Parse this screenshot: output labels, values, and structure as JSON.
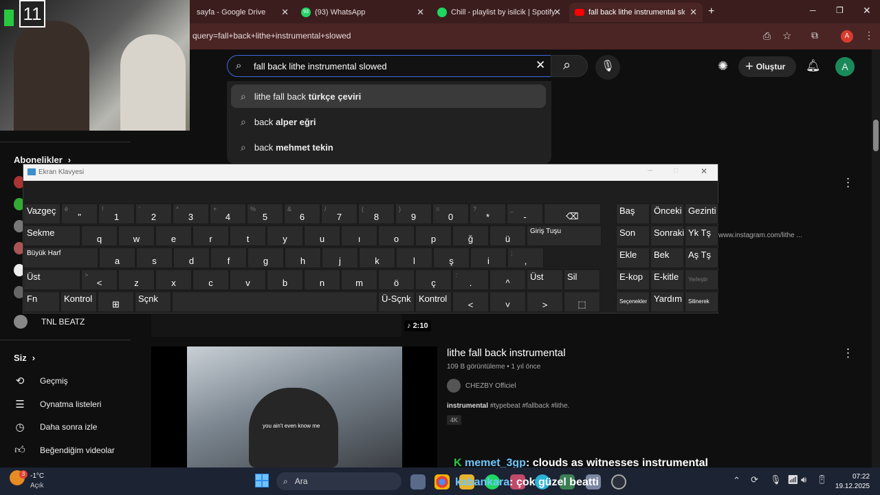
{
  "browser": {
    "tabs": [
      {
        "label": "sayfa - Google Drive"
      },
      {
        "label": "(93) WhatsApp",
        "badge": "93"
      },
      {
        "label": "Chill - playlist by isilcik | Spotify"
      },
      {
        "label": "fall back lithe instrumental slowed"
      }
    ],
    "url": "query=fall+back+lithe+instrumental+slowed",
    "profile_initial": "A"
  },
  "youtube": {
    "search": {
      "value": "fall back lithe instrumental slowed"
    },
    "suggestions": [
      {
        "prefix": "lithe fall back ",
        "bold": "türkçe çeviri"
      },
      {
        "prefix": "back ",
        "bold": "alper eğri"
      },
      {
        "prefix": "back ",
        "bold": "mehmet tekin"
      }
    ],
    "create_label": "Oluştur",
    "avatar_initial": "A",
    "sidebar": {
      "subs_header": "Abonelikler",
      "subs_last": "TNL BEATZ",
      "you_header": "Siz",
      "items": [
        "Geçmiş",
        "Oynatma listeleri",
        "Daha sonra izle",
        "Beğendiğim videolar"
      ]
    },
    "result1": {
      "snippet": "www.instagram.com/lithe ...",
      "duration": "2:10"
    },
    "result2": {
      "title": "lithe fall back instrumental",
      "meta": "109 B görüntüleme • 1 yıl önce",
      "channel": "CHEZBY Officiel",
      "desc_pre": "instrumental",
      "desc_rest": " #typebeat #fallback #lithe.",
      "badge": "4K",
      "thumb_caption": "you ain't even know me"
    }
  },
  "stream": {
    "webcam_counter": "11",
    "chat1": {
      "user": "memet_3gp",
      "msg": ": clouds as witnesses instrumental"
    },
    "chat2": {
      "user": "kabankara",
      "msg": ": çok güzel beatti"
    }
  },
  "osk": {
    "title": "Ekran Klavyesi",
    "rows": [
      [
        [
          "Vazgeç",
          ""
        ],
        [
          "\"",
          "é"
        ],
        [
          "1",
          "!"
        ],
        [
          "2",
          "'"
        ],
        [
          "3",
          "^"
        ],
        [
          "4",
          "+"
        ],
        [
          "5",
          "%"
        ],
        [
          "6",
          "&"
        ],
        [
          "7",
          "/"
        ],
        [
          "8",
          "("
        ],
        [
          "9",
          ")"
        ],
        [
          "0",
          "="
        ],
        [
          "*",
          "?"
        ],
        [
          "-",
          "_"
        ],
        [
          "⌫",
          ""
        ]
      ],
      [
        [
          "Sekme",
          ""
        ],
        [
          "q",
          ""
        ],
        [
          "w",
          ""
        ],
        [
          "e",
          ""
        ],
        [
          "r",
          ""
        ],
        [
          "t",
          ""
        ],
        [
          "y",
          ""
        ],
        [
          "u",
          ""
        ],
        [
          "ı",
          ""
        ],
        [
          "o",
          ""
        ],
        [
          "p",
          ""
        ],
        [
          "ğ",
          ""
        ],
        [
          "ü",
          ""
        ],
        [
          "Giriş Tuşu",
          ""
        ]
      ],
      [
        [
          "Büyük Harf",
          ""
        ],
        [
          "a",
          ""
        ],
        [
          "s",
          ""
        ],
        [
          "d",
          ""
        ],
        [
          "f",
          ""
        ],
        [
          "g",
          ""
        ],
        [
          "h",
          ""
        ],
        [
          "j",
          ""
        ],
        [
          "k",
          ""
        ],
        [
          "l",
          ""
        ],
        [
          "ş",
          ""
        ],
        [
          "i",
          ""
        ],
        [
          ",",
          ";"
        ]
      ],
      [
        [
          "Üst",
          ""
        ],
        [
          "<",
          ">"
        ],
        [
          "z",
          ""
        ],
        [
          "x",
          ""
        ],
        [
          "c",
          ""
        ],
        [
          "v",
          ""
        ],
        [
          "b",
          ""
        ],
        [
          "n",
          ""
        ],
        [
          "m",
          ""
        ],
        [
          "ö",
          ""
        ],
        [
          "ç",
          ""
        ],
        [
          ".",
          ":"
        ],
        [
          "^",
          ""
        ],
        [
          "Üst",
          ""
        ],
        [
          "Sil",
          ""
        ]
      ],
      [
        [
          "Fn",
          ""
        ],
        [
          "Kontrol",
          ""
        ],
        [
          "⊞",
          ""
        ],
        [
          "Sçnk",
          ""
        ],
        [
          "",
          ""
        ],
        [
          "Ü-Sçnk",
          ""
        ],
        [
          "Kontrol",
          ""
        ],
        [
          "<",
          ""
        ],
        [
          "˅",
          ""
        ],
        [
          ">",
          ""
        ],
        [
          "⬚",
          ""
        ]
      ]
    ],
    "side": [
      [
        "Baş",
        "Önceki",
        "Gezinti"
      ],
      [
        "Son",
        "Sonraki",
        "Yk Tş"
      ],
      [
        "Ekle",
        "Bek",
        "Aş Tş"
      ],
      [
        "E-kop",
        "E-kitle",
        "Yerleştir"
      ],
      [
        "Seçenekler",
        "Yardım",
        "Silinerek"
      ]
    ]
  },
  "taskbar": {
    "weather_temp": "-1°C",
    "weather_desc": "Açık",
    "weather_badge": "3",
    "search_label": "Ara",
    "time": "07:22",
    "date": "19.12.2025"
  }
}
